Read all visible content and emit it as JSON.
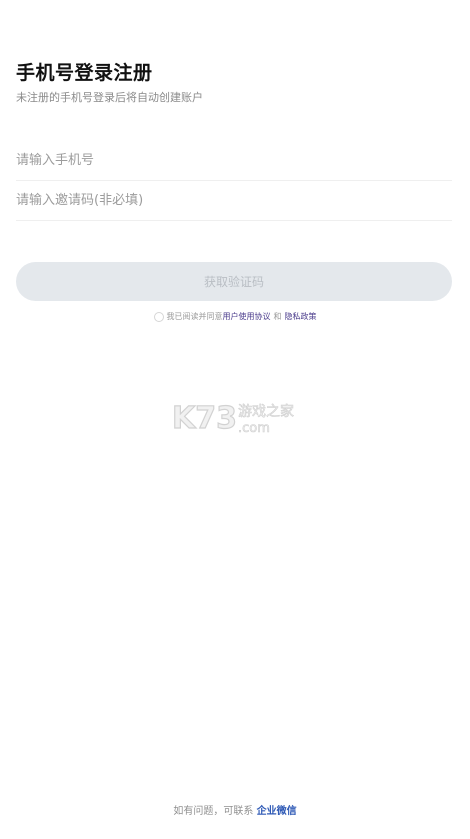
{
  "header": {
    "title": "手机号登录注册",
    "subtitle": "未注册的手机号登录后将自动创建账户"
  },
  "form": {
    "phone_placeholder": "请输入手机号",
    "invite_placeholder": "请输入邀请码(非必填)",
    "get_code_label": "获取验证码"
  },
  "agreement": {
    "prefix": "我已阅读并同意",
    "user_agreement": "用户使用协议",
    "and": "和",
    "privacy_policy": "隐私政策",
    "link_color": "#4b3c8c"
  },
  "watermark": {
    "logo_text": "K73",
    "site_name": "游戏之家",
    "domain": ".com"
  },
  "footer": {
    "text": "如有问题，可联系",
    "contact": "企业微信"
  },
  "colors": {
    "button_bg": "#e4e8ec",
    "button_text": "#b9bec4",
    "contact_link": "#2f5ab6"
  }
}
